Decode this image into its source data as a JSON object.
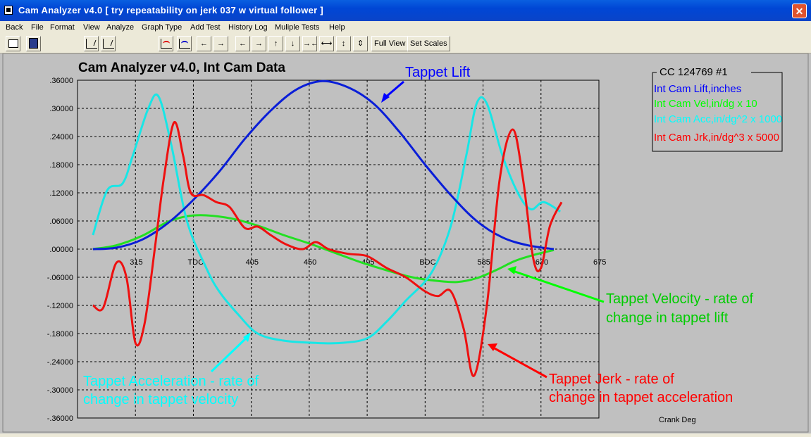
{
  "window": {
    "title": "Cam Analyzer v4.0  [ try repeatability on jerk 037 w virtual follower ]",
    "close_label": "✕"
  },
  "menu": [
    "Back",
    "File",
    "Format",
    "View",
    "Analyze",
    "Graph Type",
    "Add Test",
    "History Log",
    "Muliple Tests",
    "Help"
  ],
  "toolbar": {
    "full_view_label": "Full View",
    "set_scales_label": "Set Scales",
    "arrows": [
      "←",
      "→",
      "←",
      "→",
      "↑",
      "↓",
      "→←",
      "⟷",
      "↕",
      "⇕"
    ]
  },
  "chart": {
    "title": "Cam Analyzer v4.0,   Int Cam Data",
    "xlabel": "Crank Deg",
    "x_ticks": [
      "315",
      "TDC",
      "405",
      "450",
      "495",
      "BDC",
      "585",
      "630",
      "675"
    ],
    "y_ticks": [
      ".36000",
      ".30000",
      ".24000",
      ".18000",
      ".12000",
      ".06000",
      ".00000",
      "-.06000",
      "-.12000",
      "-.18000",
      "-.24000",
      "-.30000",
      "-.36000"
    ],
    "legend_title": "CC 124769 #1",
    "colors": {
      "lift": "#0000ff",
      "vel": "#00ff00",
      "acc": "#00ffff",
      "jerk": "#ff0000",
      "lift_line": "#0a1ed8",
      "vel_line": "#22e022",
      "acc_line": "#18e6e6",
      "jerk_line": "#ee1010"
    },
    "annotations": {
      "lift": "Tappet Lift",
      "vel_1": "Tappet Velocity - rate of",
      "vel_2": "change in tappet lift",
      "acc_1": "Tappet Acceleration - rate of",
      "acc_2": "change in tappet velocity",
      "jerk_1": "Tappet Jerk - rate of",
      "jerk_2": "change in tappet acceleration"
    }
  },
  "chart_data": {
    "type": "line",
    "title": "Cam Analyzer v4.0,   Int Cam Data",
    "xlabel": "Crank Deg",
    "ylabel": "",
    "xlim": [
      270,
      675
    ],
    "ylim": [
      -0.36,
      0.36
    ],
    "grid": true,
    "legend": "top-right",
    "series": [
      {
        "name": "Int Cam Lift,inches",
        "color": "#0000ff",
        "points": [
          [
            282,
            0
          ],
          [
            300,
            0.003
          ],
          [
            320,
            0.02
          ],
          [
            340,
            0.055
          ],
          [
            360,
            0.105
          ],
          [
            380,
            0.165
          ],
          [
            400,
            0.235
          ],
          [
            420,
            0.295
          ],
          [
            440,
            0.34
          ],
          [
            460,
            0.358
          ],
          [
            480,
            0.345
          ],
          [
            500,
            0.31
          ],
          [
            520,
            0.25
          ],
          [
            540,
            0.18
          ],
          [
            560,
            0.115
          ],
          [
            580,
            0.06
          ],
          [
            600,
            0.025
          ],
          [
            620,
            0.008
          ],
          [
            640,
            0
          ]
        ]
      },
      {
        "name": "Int Cam Vel,in/dg x 10",
        "color": "#00ff00",
        "points": [
          [
            282,
            0
          ],
          [
            300,
            0.008
          ],
          [
            320,
            0.028
          ],
          [
            340,
            0.058
          ],
          [
            355,
            0.07
          ],
          [
            370,
            0.072
          ],
          [
            390,
            0.065
          ],
          [
            410,
            0.05
          ],
          [
            430,
            0.03
          ],
          [
            450,
            0.012
          ],
          [
            470,
            -0.008
          ],
          [
            490,
            -0.028
          ],
          [
            510,
            -0.045
          ],
          [
            530,
            -0.06
          ],
          [
            550,
            -0.068
          ],
          [
            565,
            -0.07
          ],
          [
            580,
            -0.062
          ],
          [
            595,
            -0.045
          ],
          [
            610,
            -0.025
          ],
          [
            625,
            -0.012
          ],
          [
            640,
            -0.002
          ]
        ]
      },
      {
        "name": "Int Cam Acc,in/dg^2 x 1000",
        "color": "#00ffff",
        "points": [
          [
            282,
            0.03
          ],
          [
            293,
            0.125
          ],
          [
            305,
            0.14
          ],
          [
            313,
            0.2
          ],
          [
            325,
            0.3
          ],
          [
            333,
            0.325
          ],
          [
            343,
            0.22
          ],
          [
            355,
            0.06
          ],
          [
            370,
            -0.04
          ],
          [
            380,
            -0.09
          ],
          [
            395,
            -0.14
          ],
          [
            410,
            -0.18
          ],
          [
            430,
            -0.195
          ],
          [
            455,
            -0.2
          ],
          [
            475,
            -0.2
          ],
          [
            495,
            -0.19
          ],
          [
            510,
            -0.155
          ],
          [
            525,
            -0.11
          ],
          [
            545,
            -0.05
          ],
          [
            560,
            0.05
          ],
          [
            572,
            0.2
          ],
          [
            580,
            0.31
          ],
          [
            588,
            0.31
          ],
          [
            600,
            0.2
          ],
          [
            612,
            0.12
          ],
          [
            622,
            0.085
          ],
          [
            632,
            0.1
          ],
          [
            645,
            0.08
          ]
        ]
      },
      {
        "name": "Int Cam Jrk,in/dg^3 x 5000",
        "color": "#ff0000",
        "points": [
          [
            282,
            -0.12
          ],
          [
            290,
            -0.125
          ],
          [
            300,
            -0.03
          ],
          [
            308,
            -0.06
          ],
          [
            315,
            -0.2
          ],
          [
            322,
            -0.16
          ],
          [
            330,
            0.0
          ],
          [
            337,
            0.15
          ],
          [
            345,
            0.27
          ],
          [
            352,
            0.2
          ],
          [
            358,
            0.12
          ],
          [
            368,
            0.115
          ],
          [
            378,
            0.1
          ],
          [
            388,
            0.09
          ],
          [
            400,
            0.045
          ],
          [
            410,
            0.048
          ],
          [
            420,
            0.03
          ],
          [
            432,
            0.01
          ],
          [
            445,
            0.0
          ],
          [
            455,
            0.015
          ],
          [
            465,
            0.0
          ],
          [
            480,
            -0.01
          ],
          [
            495,
            -0.015
          ],
          [
            510,
            -0.04
          ],
          [
            525,
            -0.06
          ],
          [
            540,
            -0.09
          ],
          [
            550,
            -0.1
          ],
          [
            560,
            -0.09
          ],
          [
            570,
            -0.17
          ],
          [
            578,
            -0.27
          ],
          [
            588,
            -0.12
          ],
          [
            598,
            0.15
          ],
          [
            608,
            0.255
          ],
          [
            616,
            0.15
          ],
          [
            624,
            -0.02
          ],
          [
            630,
            -0.04
          ],
          [
            637,
            0.05
          ],
          [
            646,
            0.1
          ]
        ]
      }
    ]
  }
}
